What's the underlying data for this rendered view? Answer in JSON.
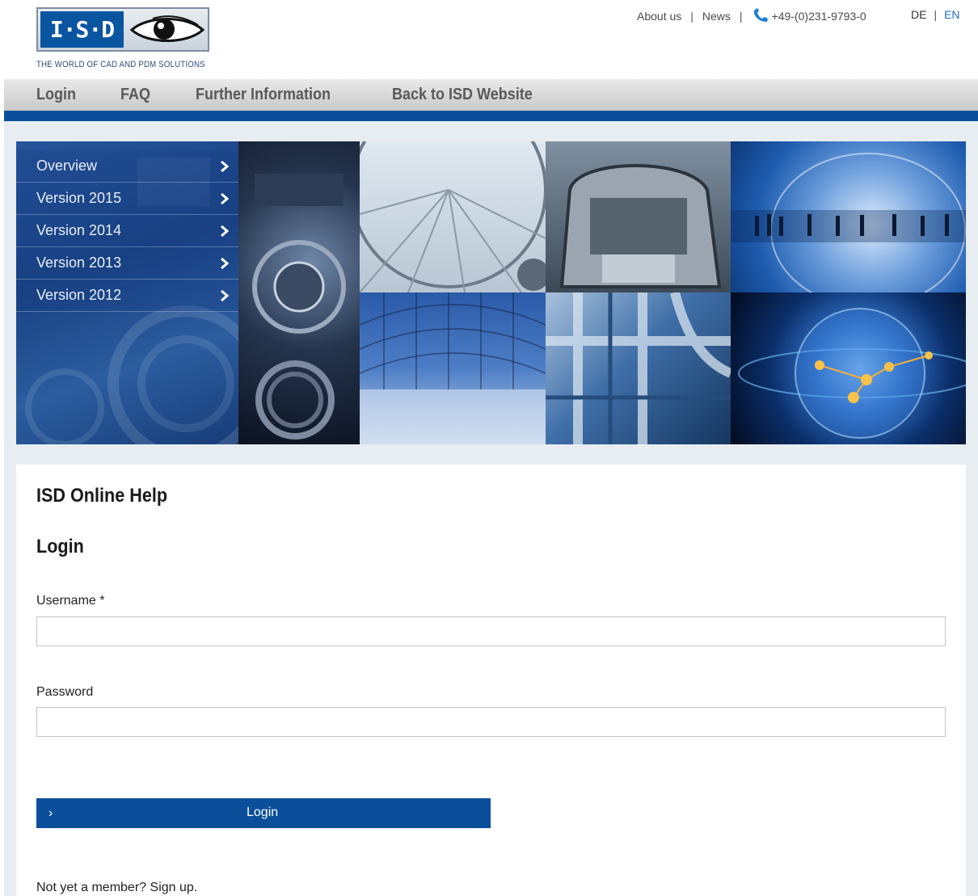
{
  "header": {
    "logo_text": "I·S·D",
    "tagline": "THE WORLD OF CAD AND PDM SOLUTIONS",
    "top_links": [
      "About us",
      "News"
    ],
    "separator": "|",
    "phone": "+49-(0)231-9793-0",
    "lang_de": "DE",
    "lang_en": "EN"
  },
  "mainnav": {
    "items": [
      "Login",
      "FAQ",
      "Further Information",
      "Back to ISD Website"
    ]
  },
  "sidemenu": {
    "items": [
      "Overview",
      "Version 2015",
      "Version 2014",
      "Version 2013",
      "Version 2012"
    ]
  },
  "content": {
    "site_title": "ISD Online Help",
    "heading": "Login",
    "username_label": "Username *",
    "username_value": "",
    "password_label": "Password",
    "password_value": "",
    "login_button": "Login",
    "login_arrow": "›",
    "signup_text": "Not yet a member?",
    "signup_link": "Sign up."
  },
  "colors": {
    "brand_blue": "#0b4f9a",
    "link_blue": "#1a6fc4",
    "nav_gray": "#595959",
    "panel_bg": "#e8edf1"
  }
}
